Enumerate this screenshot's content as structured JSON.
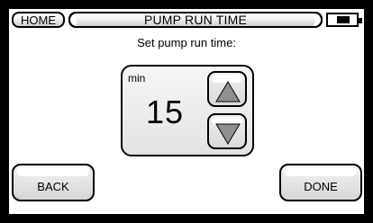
{
  "topbar": {
    "home_label": "HOME",
    "title": "PUMP RUN TIME"
  },
  "battery": {
    "icon": "battery-icon",
    "level": 0.45
  },
  "prompt": "Set pump run time:",
  "setting": {
    "unit": "min",
    "value": "15"
  },
  "icons": {
    "increase": "arrow-up-icon",
    "decrease": "arrow-down-icon"
  },
  "buttons": {
    "back": "BACK",
    "done": "DONE"
  }
}
